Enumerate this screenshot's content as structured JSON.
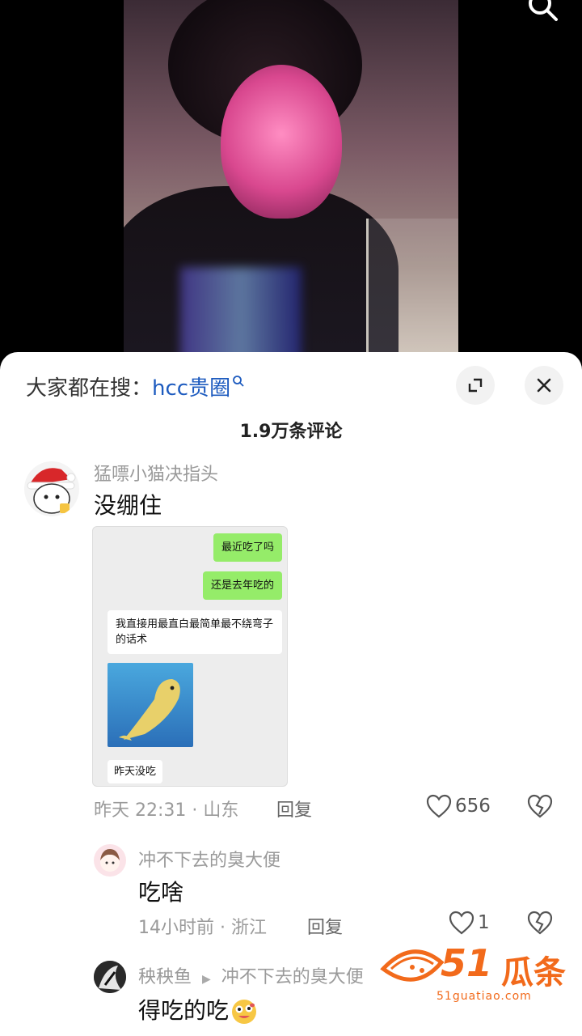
{
  "search_hint": {
    "prefix": "大家都在搜：",
    "keyword": "hcc贵圈"
  },
  "comment_count": "1.9万条评论",
  "comments": [
    {
      "username": "猛嘌小猫决指头",
      "text": "没绷住",
      "time": "昨天 22:31 · 山东",
      "reply_label": "回复",
      "likes": "656",
      "screenshot": {
        "messages": [
          "最近吃了吗",
          "还是去年吃的",
          "我直接用最直白最简单最不绕弯子的话术",
          "昨天没吃"
        ]
      }
    },
    {
      "username": "冲不下去的臭大便",
      "text": "吃啥",
      "time": "14小时前 · 浙江",
      "reply_label": "回复",
      "likes": "1"
    },
    {
      "username": "秧秧鱼",
      "reply_to": "冲不下去的臭大便",
      "text": "得吃的吃"
    }
  ],
  "watermark": {
    "number": "51",
    "text": "瓜条",
    "url": "51guatiao.com"
  },
  "colors": {
    "keyword": "#1d5bbf",
    "like_gray": "#555555",
    "watermark": "#f26a1b"
  }
}
